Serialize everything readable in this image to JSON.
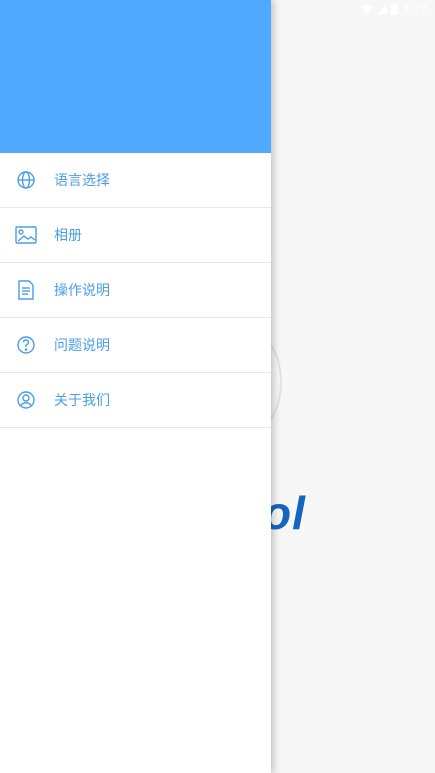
{
  "status_bar": {
    "time": "3:27"
  },
  "background": {
    "brand_text": "ol"
  },
  "menu": [
    {
      "id": "language",
      "icon": "globe-icon",
      "label": "语言选择"
    },
    {
      "id": "album",
      "icon": "image-icon",
      "label": "相册"
    },
    {
      "id": "instructions",
      "icon": "document-icon",
      "label": "操作说明"
    },
    {
      "id": "faq",
      "icon": "question-icon",
      "label": "问题说明"
    },
    {
      "id": "about",
      "icon": "user-icon",
      "label": "关于我们"
    }
  ],
  "colors": {
    "header": "#4faafe",
    "accent": "#4a9ee8",
    "brand": "#1565c0"
  }
}
